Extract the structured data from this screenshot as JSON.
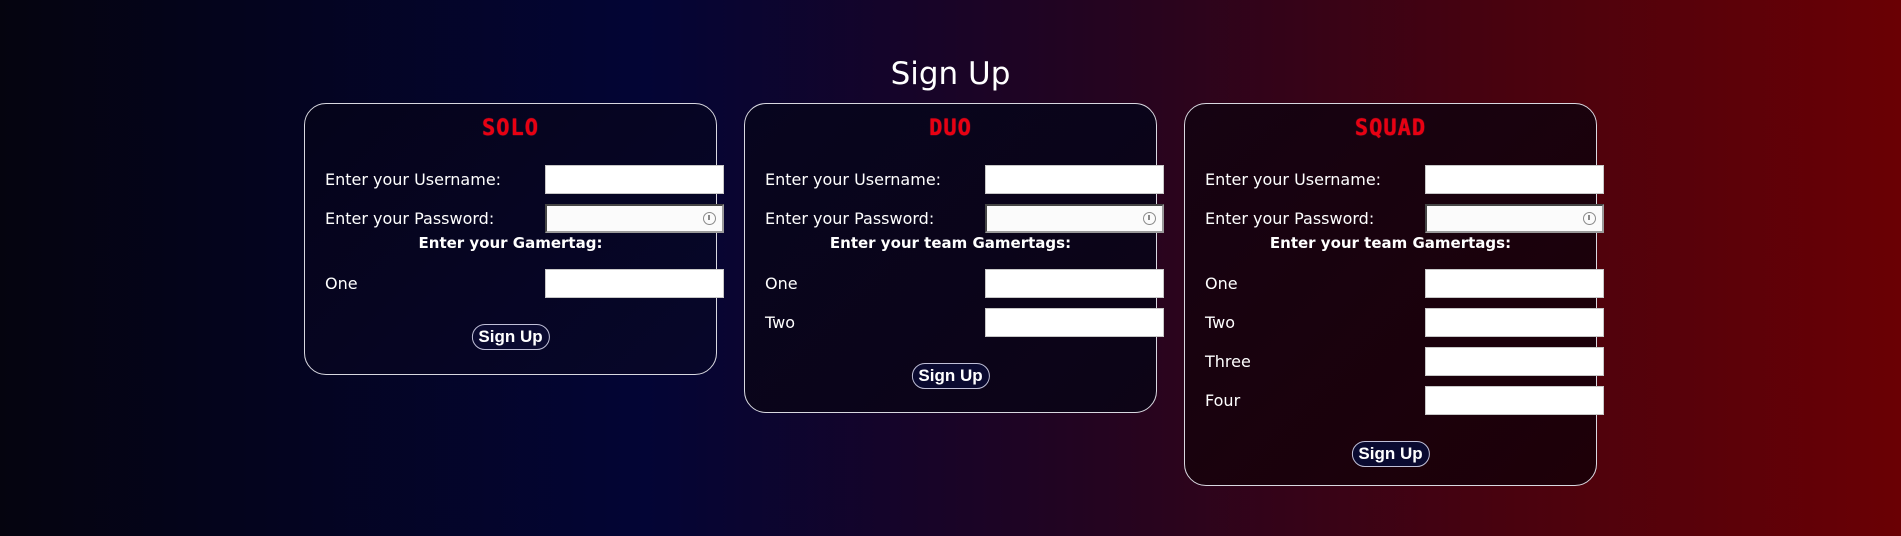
{
  "page": {
    "title": "Sign Up"
  },
  "cards": {
    "solo": {
      "title": "SOLO",
      "username_label": "Enter your Username:",
      "password_label": "Enter your Password:",
      "gamertag_heading": "Enter your Gamertag:",
      "gamertags": [
        "One"
      ],
      "button_label": "Sign Up"
    },
    "duo": {
      "title": "DUO",
      "username_label": "Enter your Username:",
      "password_label": "Enter your Password:",
      "gamertag_heading": "Enter your team Gamertags:",
      "gamertags": [
        "One",
        "Two"
      ],
      "button_label": "Sign Up"
    },
    "squad": {
      "title": "SQUAD",
      "username_label": "Enter your Username:",
      "password_label": "Enter your Password:",
      "gamertag_heading": "Enter your team Gamertags:",
      "gamertags": [
        "One",
        "Two",
        "Three",
        "Four"
      ],
      "button_label": "Sign Up"
    }
  },
  "colors": {
    "card_title": "#e80012",
    "text": "#ffffff"
  }
}
